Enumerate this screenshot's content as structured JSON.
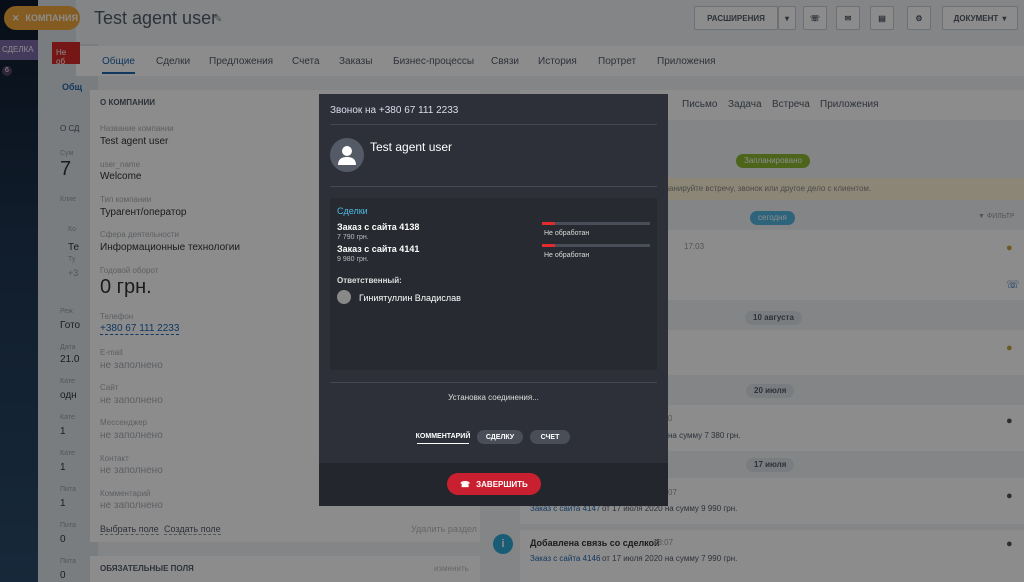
{
  "left_strip": {
    "deal_tag": "СДЕЛКА",
    "badge": "6"
  },
  "back_button": {
    "label": "КОМПАНИЯ"
  },
  "red_button": {
    "label": "Не об"
  },
  "header": {
    "title": "Test agent  user",
    "buttons": {
      "extensions": "РАСШИРЕНИЯ",
      "document": "ДОКУМЕНТ"
    }
  },
  "tabs": [
    "Общие",
    "Сделки",
    "Предложения",
    "Счета",
    "Заказы",
    "Бизнес-процессы",
    "Связи",
    "История",
    "Портрет",
    "Приложения"
  ],
  "company_card": {
    "header": "О КОМПАНИИ",
    "fields": [
      {
        "label": "Название компании",
        "value": "Test agent user"
      },
      {
        "label": "user_name",
        "value": "Welcome"
      },
      {
        "label": "Тип компании",
        "value": "Турагент/оператор"
      },
      {
        "label": "Сфера деятельности",
        "value": "Информационные технологии"
      },
      {
        "label": "Годовой оборот",
        "value": "0 грн."
      },
      {
        "label": "Телефон",
        "value": "+380 67 111 2233"
      },
      {
        "label": "E-mail",
        "value": "не заполнено"
      },
      {
        "label": "Сайт",
        "value": "не заполнено"
      },
      {
        "label": "Мессенджер",
        "value": "не заполнено"
      },
      {
        "label": "Контакт",
        "value": "не заполнено"
      },
      {
        "label": "Комментарий",
        "value": "не заполнено"
      }
    ],
    "actions": {
      "select_field": "Выбрать поле",
      "create_field": "Создать поле",
      "delete_section": "Удалить раздел"
    }
  },
  "required_card": {
    "header": "ОБЯЗАТЕЛЬНЫЕ ПОЛЯ",
    "action": "изменить"
  },
  "under_left": {
    "tab": "Общ",
    "header": "О СД",
    "items": [
      "Сум",
      "7",
      "Клие",
      "Ко",
      "Те",
      "Ту",
      "+3",
      "Реж",
      "Гото",
      "Дата",
      "21.0",
      "Кате",
      "одн",
      "Кате",
      "1",
      "Кате",
      "1",
      "Пита",
      "1",
      "Пита",
      "0",
      "Пита",
      "0"
    ]
  },
  "right_panel": {
    "tabs": [
      "Письмо",
      "Задача",
      "Встреча",
      "Приложения"
    ],
    "planned_pill": "Запланировано",
    "yellow_hint": "планируйте встречу, звонок или другое дело с клиентом.",
    "today_pill": "сегодня",
    "filter": "ФИЛЬТР",
    "time_1": "17:03",
    "date_aug": "10 августа",
    "date_jul20": "20 июля",
    "item_a_time": "0",
    "item_a_text": "на сумму 7 380 грн.",
    "date_jul17": "17 июля",
    "item_b_time": "07",
    "item_b_link": "Заказ с сайта 4147",
    "item_b_text": "от 17 июля 2020 на сумму 9 990 грн.",
    "item_c_title": "Добавлена связь со сделкой",
    "item_c_time": "18:07",
    "item_c_link": "Заказ с сайта 4146",
    "item_c_text": "от 17 июля 2020 на сумму 7 990 грн."
  },
  "call_modal": {
    "title": "Звонок на +380 67 111 2233",
    "caller": "Test agent user",
    "deals_title": "Сделки",
    "deals": [
      {
        "name": "Заказ с сайта 4138",
        "sum": "7 790 грн.",
        "status": "Не обработан",
        "progress": 0.12
      },
      {
        "name": "Заказ с сайта 4141",
        "sum": "9 980 грн.",
        "status": "Не обработан",
        "progress": 0.12
      }
    ],
    "responsible_label": "Ответственный:",
    "responsible_name": "Гиниятуллин Владислав",
    "connection_status": "Установка соединения...",
    "buttons": {
      "comment": "КОММЕНТАРИЙ",
      "deal": "СДЕЛКУ",
      "invoice": "СЧЕТ"
    },
    "end_button": "ЗАВЕРШИТЬ"
  },
  "colors": {
    "accent": "#2067b0",
    "danger": "#c8202e",
    "modal_bg": "#2d3038",
    "planned_green": "#8ab832",
    "today_blue": "#52b6e0"
  }
}
